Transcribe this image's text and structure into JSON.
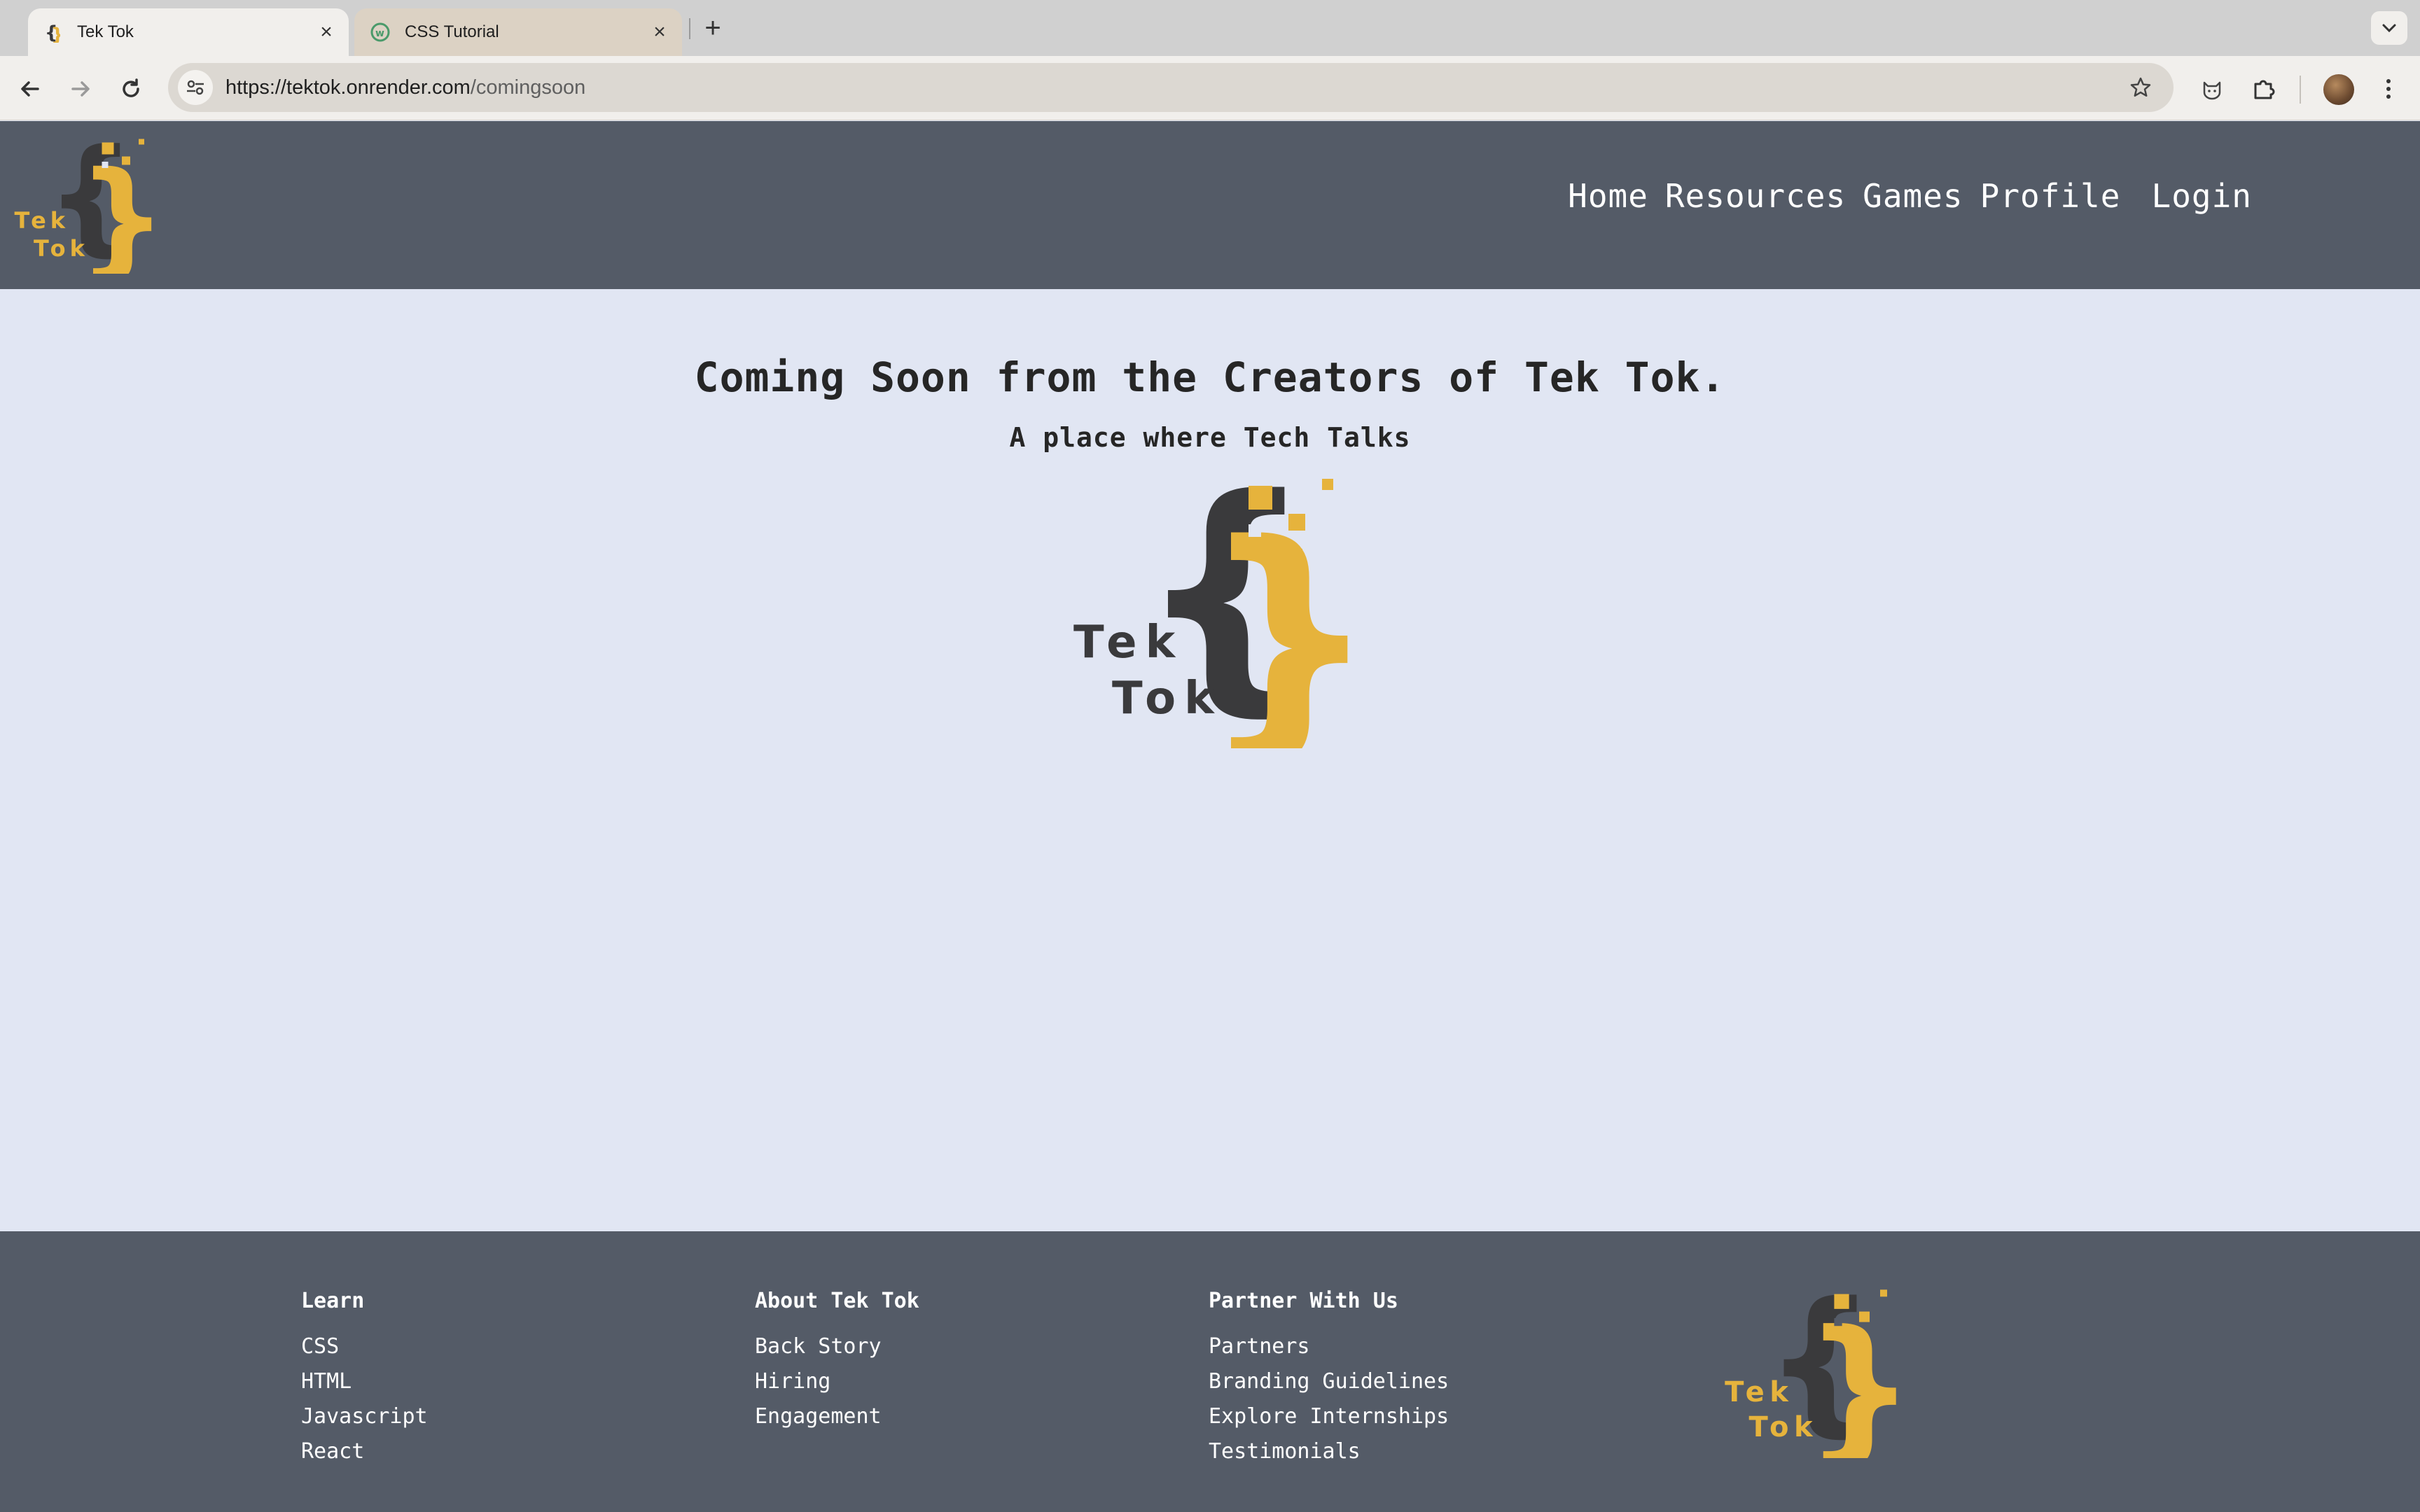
{
  "browser": {
    "tabs": [
      {
        "title": "Tek Tok",
        "active": true
      },
      {
        "title": "CSS Tutorial",
        "active": false
      }
    ],
    "url_host": "https://tektok.onrender.com",
    "url_path": "/comingsoon"
  },
  "logo": {
    "word1": "Tek",
    "word2": "Tok"
  },
  "nav": {
    "home": "Home",
    "resources": "Resources",
    "games": "Games",
    "profile": "Profile",
    "login": "Login"
  },
  "main": {
    "headline": "Coming Soon from the Creators of Tek Tok.",
    "tagline": "A place where Tech Talks"
  },
  "footer": {
    "columns": [
      {
        "title": "Learn",
        "links": [
          "CSS",
          "HTML",
          "Javascript",
          "React"
        ]
      },
      {
        "title": "About Tek Tok",
        "links": [
          "Back Story",
          "Hiring",
          "Engagement"
        ]
      },
      {
        "title": "Partner With Us",
        "links": [
          "Partners",
          "Branding Guidelines",
          "Explore Internships",
          "Testimonials"
        ]
      }
    ]
  },
  "colors": {
    "brand_dark": "#3a3a3c",
    "brand_gold": "#e6b33c",
    "header_bg": "#545b67",
    "page_bg": "#e1e6f3"
  }
}
